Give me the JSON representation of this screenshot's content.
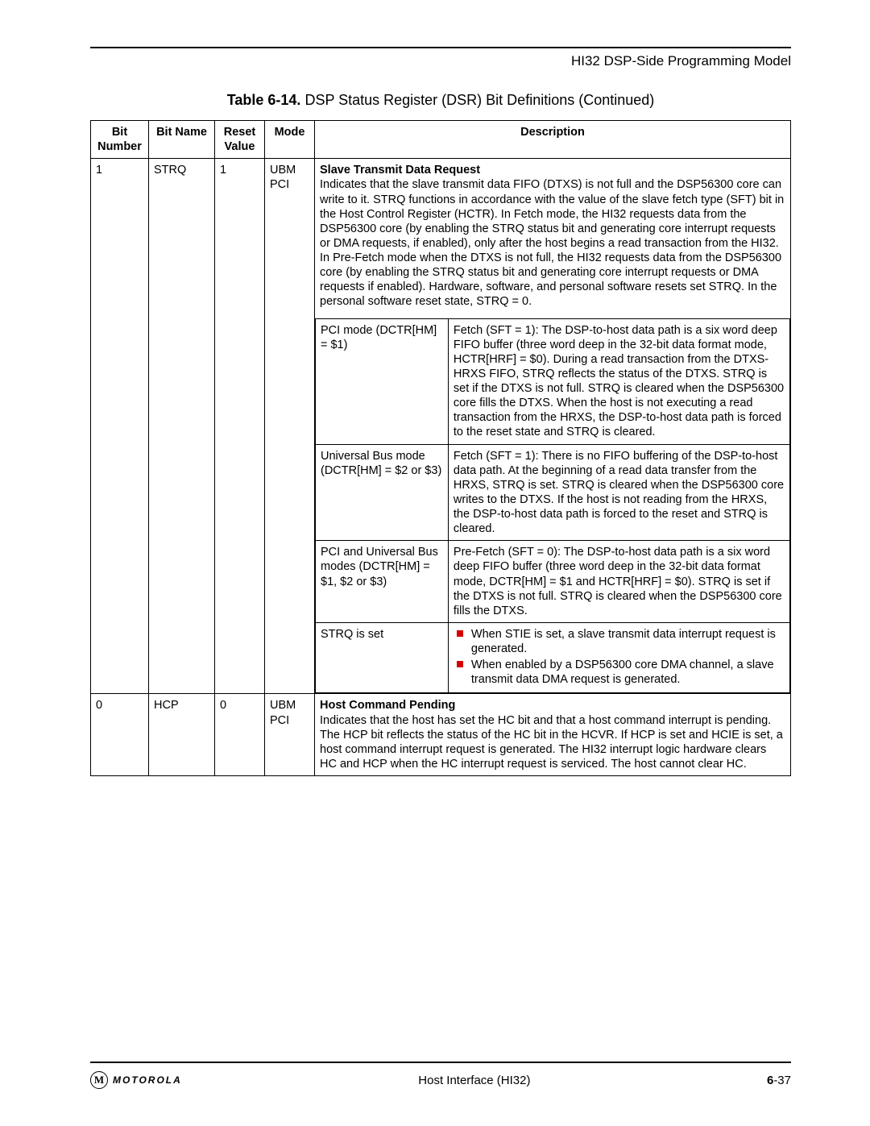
{
  "header": "HI32 DSP-Side Programming Model",
  "caption_bold": "Table 6-14.",
  "caption_rest": " DSP Status Register (DSR) Bit Definitions (Continued)",
  "cols": {
    "bit_number": "Bit Number",
    "bit_name": "Bit Name",
    "reset_value": "Reset Value",
    "mode": "Mode",
    "description": "Description"
  },
  "row1": {
    "bit_number": "1",
    "bit_name": "STRQ",
    "reset_value": "1",
    "mode_line1": "UBM",
    "mode_line2": "PCI",
    "desc_title": "Slave Transmit Data Request",
    "desc_body": "Indicates that the slave transmit data FIFO (DTXS) is not full and the DSP56300 core can write to it. STRQ functions in accordance with the value of the slave fetch type (SFT) bit in the Host Control Register (HCTR). In Fetch mode, the HI32 requests data from the DSP56300 core (by enabling the STRQ status bit and generating core interrupt requests or DMA requests, if enabled), only after the host begins a read transaction from the HI32. In Pre-Fetch mode when the DTXS is not full, the HI32 requests data from the DSP56300 core (by enabling the STRQ status bit and generating core interrupt requests or DMA requests if enabled). Hardware, software, and personal software resets set STRQ. In the personal software reset state, STRQ = 0.",
    "sub": [
      {
        "a": "PCI mode (DCTR[HM]  = $1)",
        "b": "Fetch (SFT = 1): The DSP-to-host data path is a six word deep FIFO buffer (three word deep in the 32-bit data format mode, HCTR[HRF] = $0). During a read transaction from the DTXS-HRXS FIFO, STRQ reflects the status of the DTXS. STRQ is set if the DTXS is not full. STRQ is cleared when the DSP56300 core fills the DTXS. When the host is not executing a read transaction from the HRXS, the DSP-to-host data path is forced to the reset state and STRQ is cleared."
      },
      {
        "a": "Universal Bus mode (DCTR[HM] = $2 or $3)",
        "b": "Fetch (SFT = 1): There is no FIFO buffering of the DSP-to-host data path. At the beginning of a read data transfer from the HRXS, STRQ is set. STRQ is cleared when the DSP56300 core writes to the DTXS. If the host is not reading from the HRXS, the DSP-to-host data path is forced to the reset and STRQ is cleared."
      },
      {
        "a": "PCI and Universal Bus modes (DCTR[HM] = $1, $2 or $3)",
        "b": "Pre-Fetch (SFT =  0): The DSP-to-host data path is a six word deep FIFO buffer (three word deep in the 32-bit data format mode, DCTR[HM] = $1 and HCTR[HRF] = $0). STRQ is set if the DTXS is not full. STRQ is cleared when the DSP56300 core fills the DTXS."
      },
      {
        "a": "STRQ is set",
        "bullets": [
          "When STIE is set, a slave transmit data interrupt request is generated.",
          "When enabled by a DSP56300 core DMA channel, a slave transmit data DMA request is generated."
        ]
      }
    ]
  },
  "row2": {
    "bit_number": "0",
    "bit_name": "HCP",
    "reset_value": "0",
    "mode_line1": "UBM",
    "mode_line2": "PCI",
    "desc_title": "Host Command Pending",
    "desc_body": "Indicates that the host has set the HC bit and that a host command interrupt is pending. The HCP bit reflects the status of the HC bit in the HCVR. If HCP is set and HCIE is set, a host command interrupt request is generated. The HI32 interrupt logic hardware clears HC and HCP when the HC interrupt request is serviced. The host cannot clear HC."
  },
  "footer": {
    "brand": "MOTOROLA",
    "center": "Host Interface (HI32)",
    "page_prefix": "6",
    "page_suffix": "-37"
  }
}
